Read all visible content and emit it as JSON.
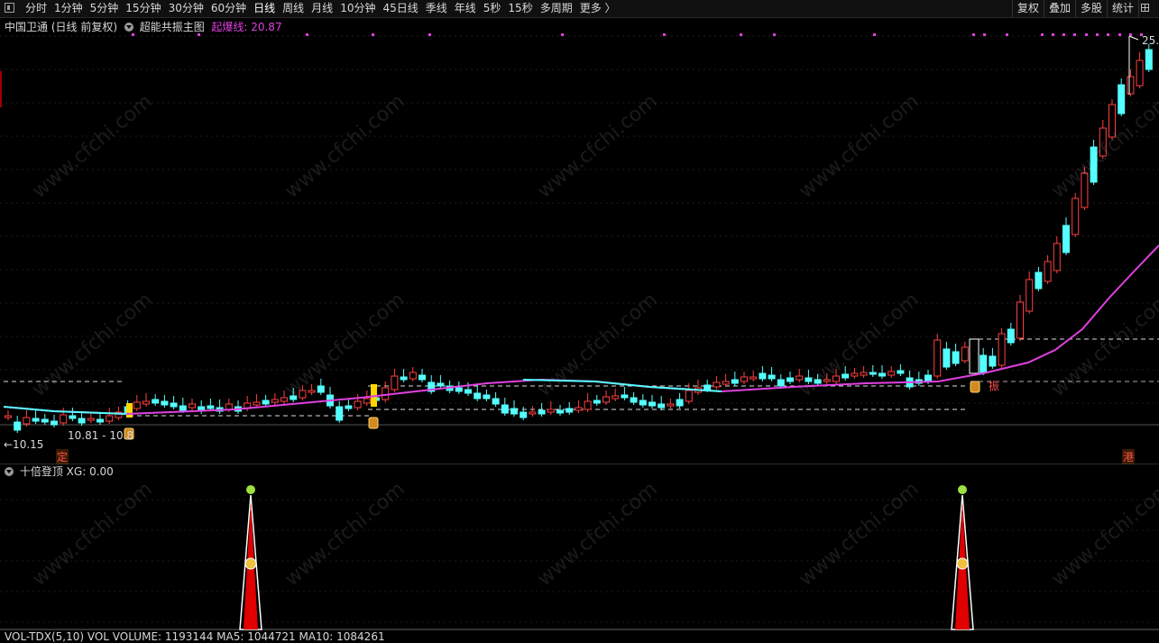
{
  "toolbar": {
    "periods": [
      "分时",
      "1分钟",
      "5分钟",
      "15分钟",
      "30分钟",
      "60分钟",
      "日线",
      "周线",
      "月线",
      "10分钟",
      "45日线",
      "季线",
      "年线",
      "5秒",
      "15秒",
      "多周期",
      "更多 〉"
    ],
    "active_period": "日线",
    "tools": [
      "复权",
      "叠加",
      "多股",
      "统计"
    ]
  },
  "main": {
    "stock_name": "中国卫通",
    "adjust_mode": "(日线 前复权)",
    "indicator_name": "超能共振主图",
    "line_label": "起爆线:",
    "line_value": "20.87",
    "low_label": "←10.15",
    "range_label": "10.81 - 10.8",
    "high_label": "25.",
    "mark_ding": "定",
    "mark_zhen": "振",
    "mark_gang": "港",
    "colors": {
      "up": "#ff4040",
      "down": "#54ffff",
      "ma": "#e040e0",
      "signal": "#ffd700"
    }
  },
  "indicator": {
    "name": "十倍登顶",
    "xg_label": "XG:",
    "xg_value": "0.00"
  },
  "footer": {
    "text": "VOL-TDX(5,10) VOL  VOLUME: 1193144  MA5: 1044721  MA10: 1084261"
  },
  "watermark": "www.cfchi.com"
}
